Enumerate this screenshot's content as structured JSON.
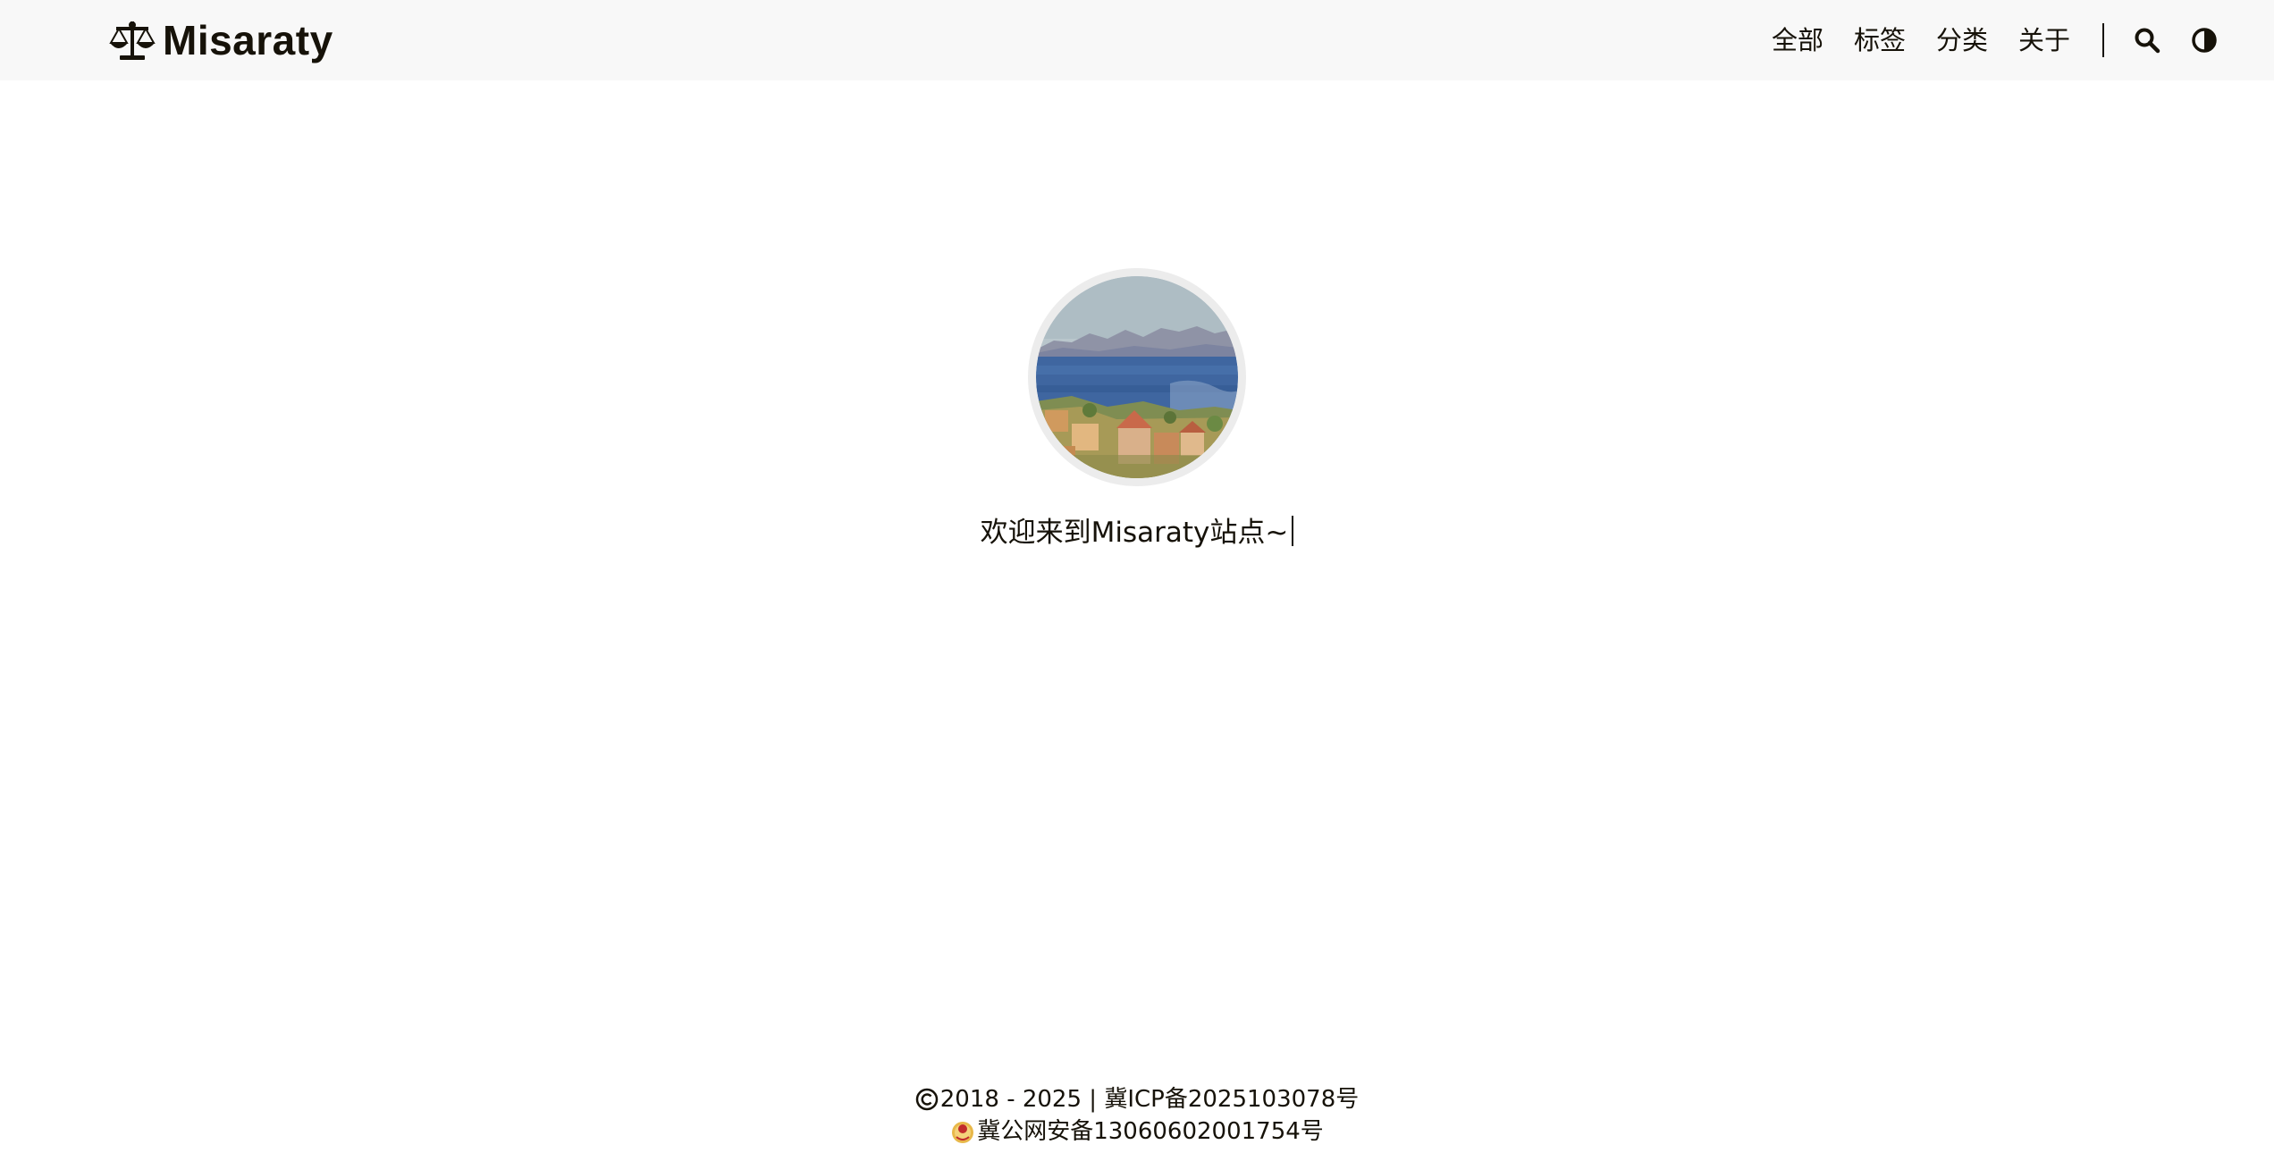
{
  "header": {
    "site_name": "Misaraty",
    "logo_icon": "balance-scale-icon",
    "nav": [
      {
        "label": "全部"
      },
      {
        "label": "标签"
      },
      {
        "label": "分类"
      },
      {
        "label": "关于"
      }
    ],
    "search_icon": "search-icon",
    "theme_icon": "theme-toggle-icon"
  },
  "hero": {
    "avatar_alt": "avatar",
    "welcome_text": "欢迎来到Misaraty站点~"
  },
  "footer": {
    "copyright_icon": "copyright-icon",
    "copyright_text": "2018 - 2025 | ",
    "icp_text": "冀ICP备2025103078号",
    "police_icon": "police-badge-icon",
    "police_text": "冀公网安备13060602001754号"
  },
  "colors": {
    "header_bg": "#f8f8f8",
    "text": "#161209",
    "avatar_ring": "#ececec"
  }
}
